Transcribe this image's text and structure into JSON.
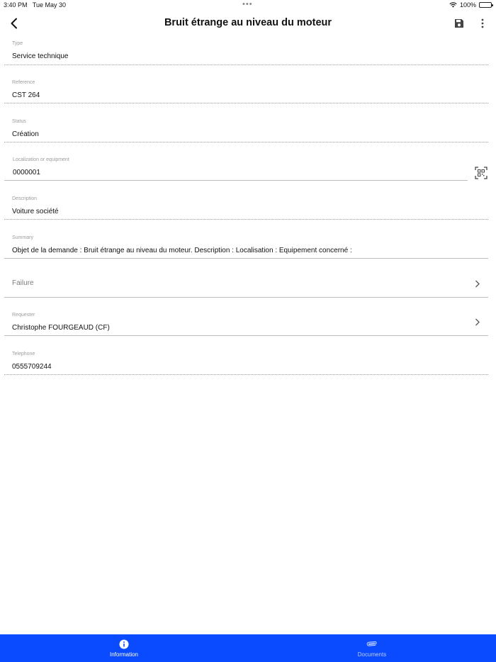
{
  "status_bar": {
    "time": "3:40 PM",
    "date": "Tue May 30",
    "dots": "•••",
    "battery_text": "100%",
    "battery_level": 1.0
  },
  "header": {
    "title": "Bruit étrange au niveau du moteur",
    "back_icon": "chevron-left-icon",
    "save_icon": "floppy-disk-icon",
    "more_icon": "more-vertical-icon"
  },
  "fields": {
    "type": {
      "label": "Type",
      "value": "Service technique"
    },
    "reference": {
      "label": "Reference",
      "value": "CST 264"
    },
    "status": {
      "label": "Status",
      "value": "Création"
    },
    "localization": {
      "label": "Localization or equipment",
      "value": "0000001",
      "icon": "qr-code-scan-icon"
    },
    "description": {
      "label": "Description",
      "value": "Voiture société"
    },
    "summary": {
      "label": "Summary",
      "value": "Objet de la demande : Bruit étrange au niveau du moteur.  Description :  Localisation :  Equipement concerné :"
    },
    "failure": {
      "placeholder": "Failure"
    },
    "requester": {
      "label": "Requester",
      "value": "Christophe FOURGEAUD (CF)"
    },
    "telephone": {
      "label": "Telephone",
      "value": "0555709244"
    }
  },
  "tabs": [
    {
      "label": "Information",
      "icon": "info-circle-icon",
      "active": true
    },
    {
      "label": "Documents",
      "icon": "paperclip-icon",
      "active": false
    }
  ],
  "colors": {
    "tabbar": "#0a4bff",
    "tab_active": "#ffffff",
    "tab_inactive": "#b9cbff",
    "label": "#9c9c9c",
    "divider": "#9a9a9a"
  }
}
